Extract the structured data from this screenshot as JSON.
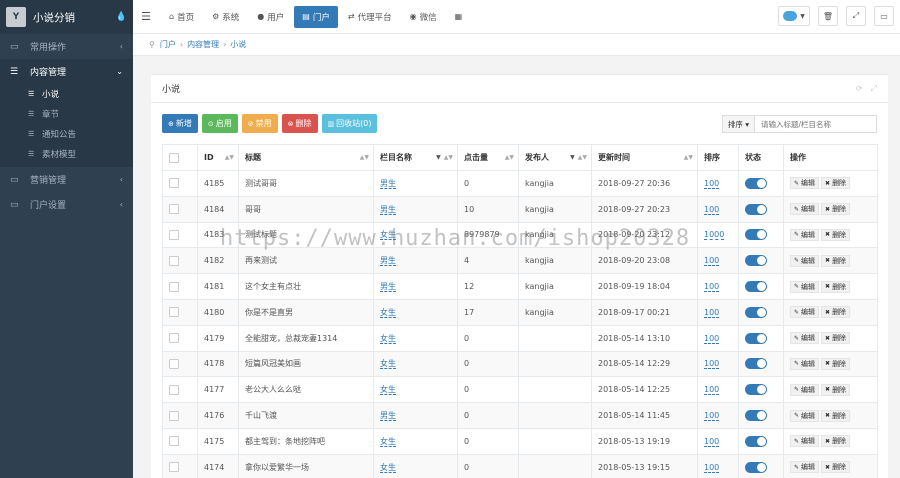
{
  "brand": {
    "name": "小说分销",
    "logo_text": "Y",
    "toggle_icon": "drop-icon"
  },
  "sidebar": {
    "items": [
      {
        "label": "常用操作",
        "icon": "folder-icon"
      },
      {
        "label": "内容管理",
        "icon": "list-icon",
        "open": true
      },
      {
        "label": "营销管理",
        "icon": "folder-icon"
      },
      {
        "label": "门户设置",
        "icon": "folder-icon"
      }
    ],
    "sub": [
      {
        "label": "小说",
        "active": true
      },
      {
        "label": "章节"
      },
      {
        "label": "通知公告"
      },
      {
        "label": "素材模型"
      }
    ]
  },
  "topnav": {
    "tabs": [
      {
        "label": "首页",
        "icon": "home-icon",
        "glyph": "⌂"
      },
      {
        "label": "系统",
        "icon": "gear-icon",
        "glyph": "⚙"
      },
      {
        "label": "用户",
        "icon": "user-icon",
        "glyph": "👤"
      },
      {
        "label": "门户",
        "icon": "portal-icon",
        "glyph": "▤",
        "active": true
      },
      {
        "label": "代理平台",
        "icon": "agent-icon",
        "glyph": "⇄"
      },
      {
        "label": "微信",
        "icon": "wechat-icon",
        "glyph": "◉"
      },
      {
        "label": "",
        "icon": "grid-icon",
        "glyph": "▦"
      }
    ]
  },
  "breadcrumb": {
    "items": [
      "门户",
      "内容管理",
      "小说"
    ]
  },
  "panel": {
    "title": "小说",
    "buttons": {
      "add": "新增",
      "enable": "启用",
      "disable": "禁用",
      "delete": "删除",
      "recycle": "回收站(0)"
    },
    "search": {
      "sort_label": "排序",
      "placeholder": "请输入标题/栏目名称"
    }
  },
  "table": {
    "headers": {
      "id": "ID",
      "title": "标题",
      "column": "栏目名称",
      "clicks": "点击量",
      "publisher": "发布人",
      "updated": "更新时间",
      "order": "排序",
      "status": "状态",
      "actions": "操作"
    },
    "action_labels": {
      "edit": "编辑",
      "delete": "删除"
    },
    "rows": [
      {
        "id": "4185",
        "title": "测试哥哥",
        "column": "男生",
        "clicks": "0",
        "publisher": "kangjia",
        "updated": "2018-09-27 20:36",
        "order": "100",
        "enabled": true
      },
      {
        "id": "4184",
        "title": "哥哥",
        "column": "男生",
        "clicks": "10",
        "publisher": "kangjia",
        "updated": "2018-09-27 20:23",
        "order": "100",
        "enabled": true
      },
      {
        "id": "4183",
        "title": "测试标题",
        "column": "女生",
        "clicks": "8979879",
        "publisher": "kangjia",
        "updated": "2018-09-20 23:12",
        "order": "1000",
        "enabled": true
      },
      {
        "id": "4182",
        "title": "再来测试",
        "column": "男生",
        "clicks": "4",
        "publisher": "kangjia",
        "updated": "2018-09-20 23:08",
        "order": "100",
        "enabled": true
      },
      {
        "id": "4181",
        "title": "这个女主有点壮",
        "column": "男生",
        "clicks": "12",
        "publisher": "kangjia",
        "updated": "2018-09-19 18:04",
        "order": "100",
        "enabled": true
      },
      {
        "id": "4180",
        "title": "你是不是直男",
        "column": "女生",
        "clicks": "17",
        "publisher": "kangjia",
        "updated": "2018-09-17 00:21",
        "order": "100",
        "enabled": true
      },
      {
        "id": "4179",
        "title": "全能甜宠，总裁宠妻1314",
        "column": "女生",
        "clicks": "0",
        "publisher": "",
        "updated": "2018-05-14 13:10",
        "order": "100",
        "enabled": true
      },
      {
        "id": "4178",
        "title": "短篇风冠美如画",
        "column": "女生",
        "clicks": "0",
        "publisher": "",
        "updated": "2018-05-14 12:29",
        "order": "100",
        "enabled": true
      },
      {
        "id": "4177",
        "title": "老公大人么么哒",
        "column": "女生",
        "clicks": "0",
        "publisher": "",
        "updated": "2018-05-14 12:25",
        "order": "100",
        "enabled": true
      },
      {
        "id": "4176",
        "title": "千山飞渡",
        "column": "男生",
        "clicks": "0",
        "publisher": "",
        "updated": "2018-05-14 11:45",
        "order": "100",
        "enabled": true
      },
      {
        "id": "4175",
        "title": "都主驾到：条地挖阵吧",
        "column": "女生",
        "clicks": "0",
        "publisher": "",
        "updated": "2018-05-13 19:19",
        "order": "100",
        "enabled": true
      },
      {
        "id": "4174",
        "title": "拿你以爱繁华一场",
        "column": "女生",
        "clicks": "0",
        "publisher": "",
        "updated": "2018-05-13 19:15",
        "order": "100",
        "enabled": true
      }
    ]
  },
  "watermark": "https://www.huzhan.com/ishop20328",
  "colors": {
    "sidebar": "#2f4050",
    "primary": "#337ab7",
    "success": "#5cb85c",
    "warning": "#f0ad4e",
    "danger": "#d9534f",
    "info": "#5bc0de"
  }
}
